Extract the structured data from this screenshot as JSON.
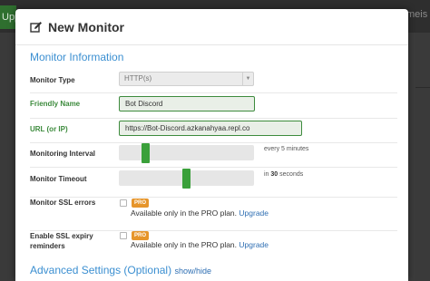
{
  "background": {
    "left_text": "Upp",
    "right_text": "meis"
  },
  "modal": {
    "title": "New Monitor",
    "title_icon": "edit-icon",
    "section_title": "Monitor Information",
    "fields": {
      "monitor_type": {
        "label": "Monitor Type",
        "value": "HTTP(s)"
      },
      "friendly_name": {
        "label": "Friendly Name",
        "value": "Bot Discord"
      },
      "url": {
        "label": "URL (or IP)",
        "value": "https://Bot-Discord.azkanahyaa.repl.co"
      },
      "interval": {
        "label": "Monitoring Interval",
        "note": "every 5 minutes",
        "level": 0.2
      },
      "timeout": {
        "label": "Monitor Timeout",
        "note_prefix": "in",
        "note_value": "30",
        "note_suffix": "seconds",
        "level": 0.5
      },
      "ssl_errors": {
        "label": "Monitor SSL errors",
        "badge": "PRO",
        "text": "Available only in the PRO plan.",
        "link": "Upgrade"
      },
      "ssl_expiry": {
        "label_line1": "Enable SSL expiry",
        "label_line2": "reminders",
        "badge": "PRO",
        "text": "Available only in the PRO plan.",
        "link": "Upgrade"
      }
    },
    "advanced": {
      "title": "Advanced Settings (Optional)",
      "toggle": "show/hide"
    }
  },
  "colors": {
    "accent_blue": "#3b8fd1",
    "valid_green": "#3d8b3d",
    "slider_green": "#3aa03a",
    "pro_orange": "#e6952b"
  }
}
